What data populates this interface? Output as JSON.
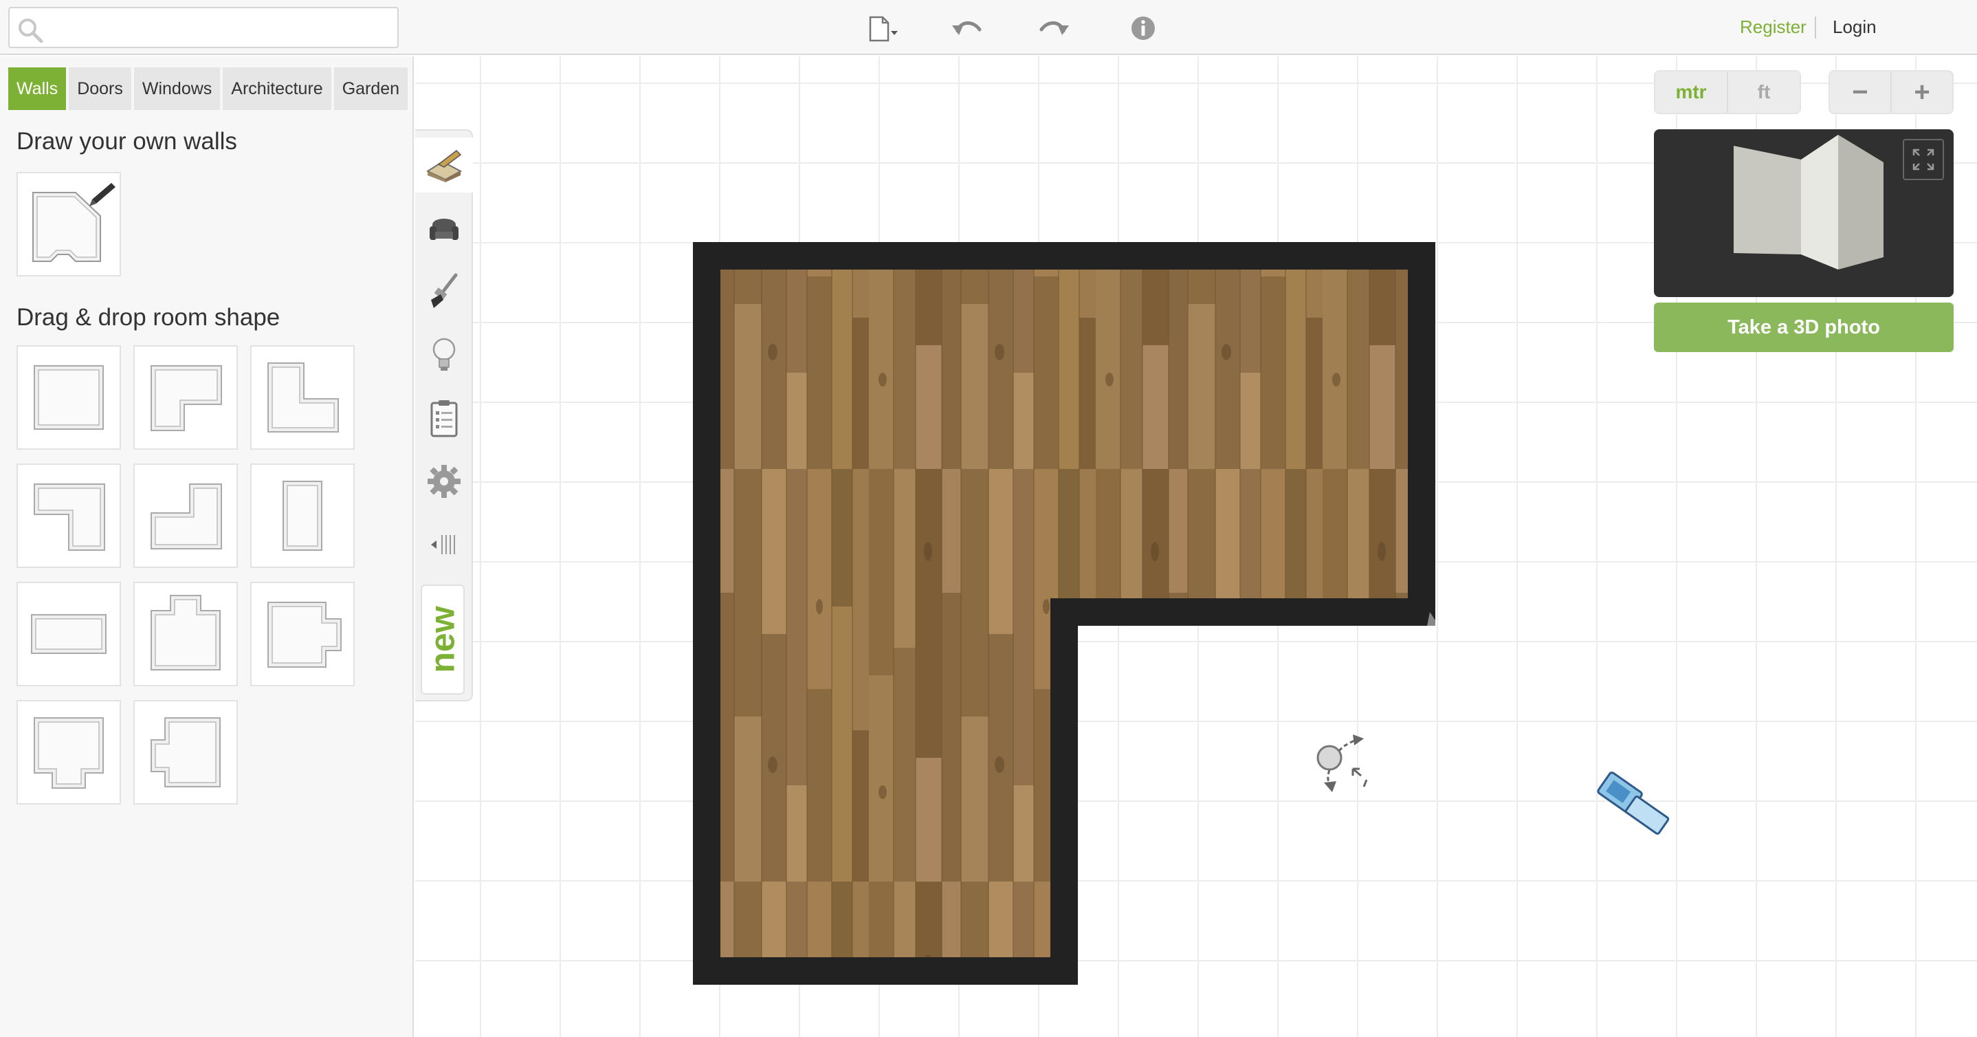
{
  "search": {
    "placeholder": "",
    "value": ""
  },
  "toolbar": {
    "icons": [
      "document-menu-icon",
      "undo-icon",
      "redo-icon",
      "info-icon"
    ]
  },
  "auth": {
    "register": "Register",
    "login": "Login"
  },
  "tabs": [
    {
      "label": "Walls",
      "active": true
    },
    {
      "label": "Doors",
      "active": false
    },
    {
      "label": "Windows",
      "active": false
    },
    {
      "label": "Architecture",
      "active": false
    },
    {
      "label": "Garden",
      "active": false
    }
  ],
  "panel": {
    "draw_title": "Draw your own walls",
    "shapes_title": "Drag & drop room shape"
  },
  "vtoolbar": {
    "items": [
      "construction-icon",
      "furniture-icon",
      "paint-icon",
      "lighting-icon",
      "checklist-icon",
      "settings-icon",
      "collapse-icon"
    ],
    "new_label": "new"
  },
  "units": {
    "metric": "mtr",
    "imperial": "ft",
    "selected": "mtr"
  },
  "zoom": {
    "out": "−",
    "in": "+"
  },
  "photo_button": "Take a 3D photo",
  "colors": {
    "accent": "#7cb135",
    "wall": "#222222",
    "floor": "#9b7a4e",
    "preview_bg": "#303030"
  }
}
